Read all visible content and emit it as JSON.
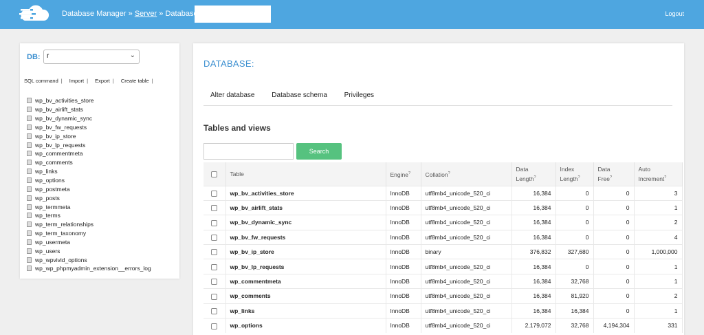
{
  "header": {
    "app_name": "Database Manager",
    "sep1": "»",
    "server_link": "Server",
    "sep2": "»",
    "database_label": "Database:",
    "logout": "Logout"
  },
  "sidebar": {
    "db_label": "DB:",
    "db_value": "r",
    "commands": [
      "SQL command",
      "Import",
      "Export",
      "Create table"
    ],
    "tables": [
      "wp_bv_activities_store",
      "wp_bv_airlift_stats",
      "wp_bv_dynamic_sync",
      "wp_bv_fw_requests",
      "wp_bv_ip_store",
      "wp_bv_lp_requests",
      "wp_commentmeta",
      "wp_comments",
      "wp_links",
      "wp_options",
      "wp_postmeta",
      "wp_posts",
      "wp_termmeta",
      "wp_terms",
      "wp_term_relationships",
      "wp_term_taxonomy",
      "wp_usermeta",
      "wp_users",
      "wp_wpvivid_options",
      "wp_wp_phpmyadmin_extension__errors_log"
    ]
  },
  "main": {
    "title": "DATABASE:",
    "tabs": [
      "Alter database",
      "Database schema",
      "Privileges"
    ],
    "section_title": "Tables and views",
    "search_button": "Search",
    "columns": {
      "table": "Table",
      "engine": "Engine",
      "collation": "Collation",
      "data_length_1": "Data",
      "data_length_2": "Length",
      "index_length_1": "Index",
      "index_length_2": "Length",
      "data_free_1": "Data",
      "data_free_2": "Free",
      "auto_inc_1": "Auto",
      "auto_inc_2": "Increment",
      "help": "?"
    },
    "rows": [
      {
        "name": "wp_bv_activities_store",
        "engine": "InnoDB",
        "collation": "utf8mb4_unicode_520_ci",
        "data_length": "16,384",
        "index_length": "0",
        "data_free": "0",
        "auto_increment": "3"
      },
      {
        "name": "wp_bv_airlift_stats",
        "engine": "InnoDB",
        "collation": "utf8mb4_unicode_520_ci",
        "data_length": "16,384",
        "index_length": "0",
        "data_free": "0",
        "auto_increment": "1"
      },
      {
        "name": "wp_bv_dynamic_sync",
        "engine": "InnoDB",
        "collation": "utf8mb4_unicode_520_ci",
        "data_length": "16,384",
        "index_length": "0",
        "data_free": "0",
        "auto_increment": "2"
      },
      {
        "name": "wp_bv_fw_requests",
        "engine": "InnoDB",
        "collation": "utf8mb4_unicode_520_ci",
        "data_length": "16,384",
        "index_length": "0",
        "data_free": "0",
        "auto_increment": "4"
      },
      {
        "name": "wp_bv_ip_store",
        "engine": "InnoDB",
        "collation": "binary",
        "data_length": "376,832",
        "index_length": "327,680",
        "data_free": "0",
        "auto_increment": "1,000,000"
      },
      {
        "name": "wp_bv_lp_requests",
        "engine": "InnoDB",
        "collation": "utf8mb4_unicode_520_ci",
        "data_length": "16,384",
        "index_length": "0",
        "data_free": "0",
        "auto_increment": "1"
      },
      {
        "name": "wp_commentmeta",
        "engine": "InnoDB",
        "collation": "utf8mb4_unicode_520_ci",
        "data_length": "16,384",
        "index_length": "32,768",
        "data_free": "0",
        "auto_increment": "1"
      },
      {
        "name": "wp_comments",
        "engine": "InnoDB",
        "collation": "utf8mb4_unicode_520_ci",
        "data_length": "16,384",
        "index_length": "81,920",
        "data_free": "0",
        "auto_increment": "2"
      },
      {
        "name": "wp_links",
        "engine": "InnoDB",
        "collation": "utf8mb4_unicode_520_ci",
        "data_length": "16,384",
        "index_length": "16,384",
        "data_free": "0",
        "auto_increment": "1"
      },
      {
        "name": "wp_options",
        "engine": "InnoDB",
        "collation": "utf8mb4_unicode_520_ci",
        "data_length": "2,179,072",
        "index_length": "32,768",
        "data_free": "4,194,304",
        "auto_increment": "331"
      }
    ]
  }
}
